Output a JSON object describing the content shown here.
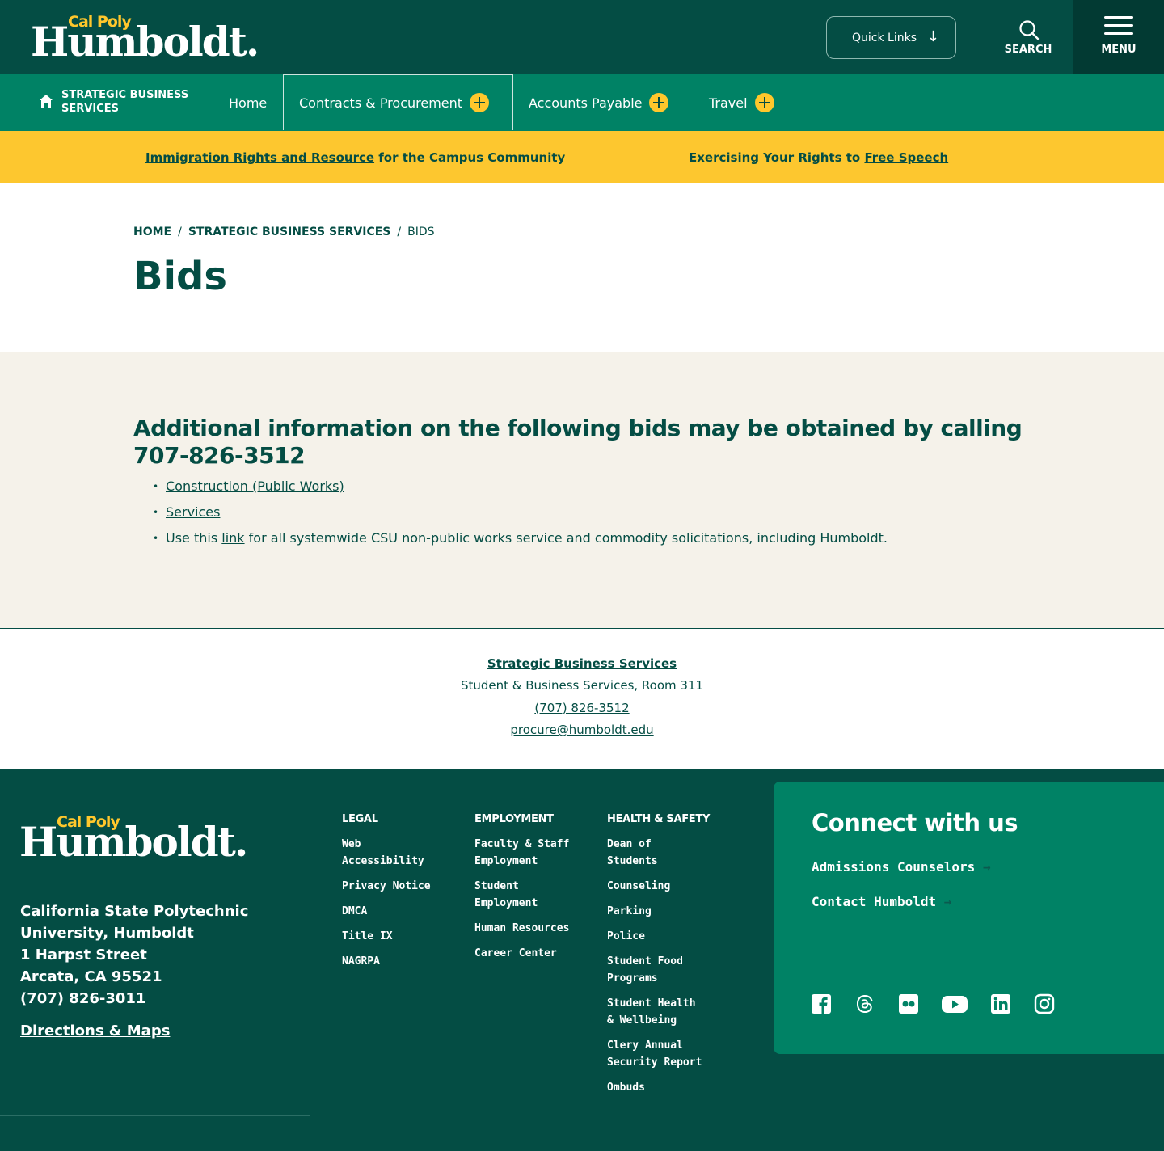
{
  "header": {
    "logo_top": "Cal Poly",
    "logo_main": "Humboldt.",
    "quick_links": "Quick Links",
    "search_label": "SEARCH",
    "menu_label": "MENU"
  },
  "nav": {
    "section": "STRATEGIC BUSINESS SERVICES",
    "items": [
      {
        "label": "Home"
      },
      {
        "label": "Contracts & Procurement"
      },
      {
        "label": "Accounts Payable"
      },
      {
        "label": "Travel"
      }
    ]
  },
  "alerts": {
    "a1_link": "Immigration Rights and Resource",
    "a1_rest": " for the Campus Community",
    "a2_lead": "Exercising Your Rights to ",
    "a2_link": "Free Speech"
  },
  "breadcrumb": {
    "home": "HOME",
    "sep": "/",
    "section": "STRATEGIC BUSINESS SERVICES",
    "current": "BIDS"
  },
  "page_title": "Bids",
  "content": {
    "heading": "Additional information on the following bids may be obtained by calling 707-826-3512",
    "item1": "Construction (Public Works)",
    "item2": "Services",
    "item3_lead": "Use this ",
    "item3_link": "link",
    "item3_rest": " for all systemwide CSU non-public works service and commodity solicitations, including Humboldt."
  },
  "contact": {
    "name": "Strategic Business Services",
    "location": "Student & Business Services, Room 311",
    "phone": "(707) 826-3512",
    "email": "procure@humboldt.edu"
  },
  "footer": {
    "logo_top": "Cal Poly",
    "logo_main": "Humboldt.",
    "address": [
      "California State Polytechnic",
      "University, Humboldt",
      "1 Harpst Street",
      "Arcata, CA 95521",
      "(707) 826-3011"
    ],
    "directions": "Directions & Maps",
    "legal": {
      "heading": "LEGAL",
      "links": [
        "Web Accessibility",
        "Privacy Notice",
        "DMCA",
        "Title IX",
        "NAGRPA"
      ]
    },
    "employment": {
      "heading": "EMPLOYMENT",
      "links": [
        "Faculty & Staff Employment",
        "Student Employment",
        "Human Resources",
        "Career Center"
      ]
    },
    "health": {
      "heading": "HEALTH & SAFETY",
      "links": [
        "Dean of Students",
        "Counseling",
        "Parking",
        "Police",
        "Student Food Programs",
        "Student Health & Wellbeing",
        "Clery Annual Security Report",
        "Ombuds"
      ]
    },
    "connect": {
      "heading": "Connect with us",
      "link1": "Admissions Counselors",
      "link2": "Contact Humboldt"
    },
    "social_icons": [
      "facebook-icon",
      "threads-icon",
      "flickr-icon",
      "youtube-icon",
      "linkedin-icon",
      "instagram-icon"
    ]
  },
  "colors": {
    "dark_green": "#044d44",
    "green": "#008265",
    "gold": "#ffc72c",
    "cream": "#f5f2ea"
  }
}
